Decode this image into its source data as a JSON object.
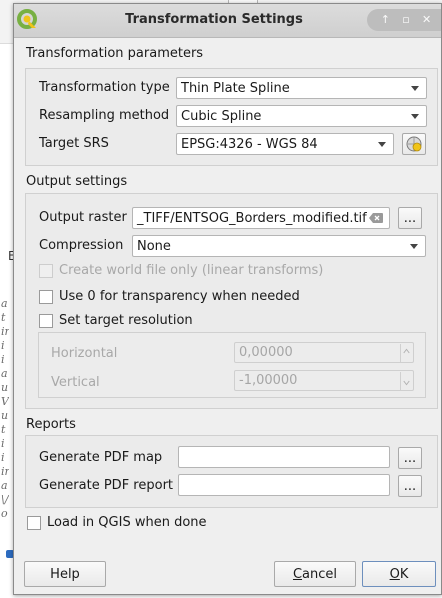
{
  "dialog": {
    "title": "Transformation Settings",
    "window_buttons": [
      "↑",
      "▫",
      "✕"
    ]
  },
  "transformation_parameters": {
    "title": "Transformation parameters",
    "transformation_type_label": "Transformation type",
    "transformation_type_value": "Thin Plate Spline",
    "resampling_method_label": "Resampling method",
    "resampling_method_value": "Cubic Spline",
    "target_srs_label": "Target SRS",
    "target_srs_value": "EPSG:4326 - WGS 84"
  },
  "output_settings": {
    "title": "Output settings",
    "output_raster_label": "Output raster",
    "output_raster_value": "_TIFF/ENTSOG_Borders_modified.tif",
    "browse_label": "...",
    "compression_label": "Compression",
    "compression_value": "None",
    "world_file_label": "Create world file only (linear transforms)",
    "world_file_checked": false,
    "world_file_enabled": false,
    "transparency_label": "Use 0 for transparency when needed",
    "transparency_checked": false,
    "target_resolution_label": "Set target resolution",
    "target_resolution_checked": false,
    "horizontal_label": "Horizontal",
    "horizontal_value": "0,00000",
    "vertical_label": "Vertical",
    "vertical_value": "-1,00000"
  },
  "reports": {
    "title": "Reports",
    "pdf_map_label": "Generate PDF map",
    "pdf_map_value": "",
    "pdf_report_label": "Generate PDF report",
    "pdf_report_value": "",
    "browse_label": "..."
  },
  "load_in_qgis": {
    "label": "Load in QGIS when done",
    "checked": false
  },
  "buttons": {
    "help": "Help",
    "cancel_prefix": "",
    "cancel_mnemonic": "C",
    "cancel_rest": "ancel",
    "ok_mnemonic": "O",
    "ok_rest": "K"
  },
  "background_app": {
    "side_letter": "E",
    "side_text": [
      "a",
      "t",
      "ir",
      "i",
      "i",
      "a",
      "u",
      "V",
      "u",
      "t",
      "i",
      "i",
      "ir",
      "a",
      "\\/",
      "o"
    ]
  },
  "colors": {
    "qgis_green": "#78b042",
    "qgis_yellow": "#f0c419",
    "accent_blue": "#2d6cc0"
  },
  "icons": {
    "app_logo": "qgis-logo-icon",
    "srs_selector": "globe-projection-icon",
    "clear": "clear-field-icon"
  }
}
